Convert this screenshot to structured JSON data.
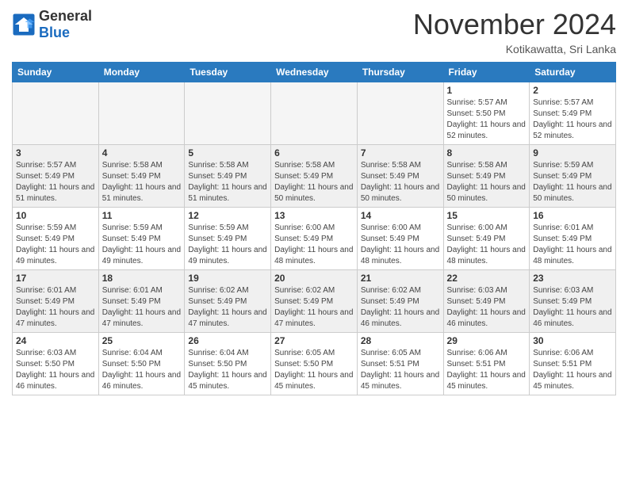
{
  "header": {
    "logo_general": "General",
    "logo_blue": "Blue",
    "month_title": "November 2024",
    "location": "Kotikawatta, Sri Lanka"
  },
  "weekdays": [
    "Sunday",
    "Monday",
    "Tuesday",
    "Wednesday",
    "Thursday",
    "Friday",
    "Saturday"
  ],
  "weeks": [
    [
      {
        "day": "",
        "info": ""
      },
      {
        "day": "",
        "info": ""
      },
      {
        "day": "",
        "info": ""
      },
      {
        "day": "",
        "info": ""
      },
      {
        "day": "",
        "info": ""
      },
      {
        "day": "1",
        "info": "Sunrise: 5:57 AM\nSunset: 5:50 PM\nDaylight: 11 hours and 52 minutes."
      },
      {
        "day": "2",
        "info": "Sunrise: 5:57 AM\nSunset: 5:49 PM\nDaylight: 11 hours and 52 minutes."
      }
    ],
    [
      {
        "day": "3",
        "info": "Sunrise: 5:57 AM\nSunset: 5:49 PM\nDaylight: 11 hours and 51 minutes."
      },
      {
        "day": "4",
        "info": "Sunrise: 5:58 AM\nSunset: 5:49 PM\nDaylight: 11 hours and 51 minutes."
      },
      {
        "day": "5",
        "info": "Sunrise: 5:58 AM\nSunset: 5:49 PM\nDaylight: 11 hours and 51 minutes."
      },
      {
        "day": "6",
        "info": "Sunrise: 5:58 AM\nSunset: 5:49 PM\nDaylight: 11 hours and 50 minutes."
      },
      {
        "day": "7",
        "info": "Sunrise: 5:58 AM\nSunset: 5:49 PM\nDaylight: 11 hours and 50 minutes."
      },
      {
        "day": "8",
        "info": "Sunrise: 5:58 AM\nSunset: 5:49 PM\nDaylight: 11 hours and 50 minutes."
      },
      {
        "day": "9",
        "info": "Sunrise: 5:59 AM\nSunset: 5:49 PM\nDaylight: 11 hours and 50 minutes."
      }
    ],
    [
      {
        "day": "10",
        "info": "Sunrise: 5:59 AM\nSunset: 5:49 PM\nDaylight: 11 hours and 49 minutes."
      },
      {
        "day": "11",
        "info": "Sunrise: 5:59 AM\nSunset: 5:49 PM\nDaylight: 11 hours and 49 minutes."
      },
      {
        "day": "12",
        "info": "Sunrise: 5:59 AM\nSunset: 5:49 PM\nDaylight: 11 hours and 49 minutes."
      },
      {
        "day": "13",
        "info": "Sunrise: 6:00 AM\nSunset: 5:49 PM\nDaylight: 11 hours and 48 minutes."
      },
      {
        "day": "14",
        "info": "Sunrise: 6:00 AM\nSunset: 5:49 PM\nDaylight: 11 hours and 48 minutes."
      },
      {
        "day": "15",
        "info": "Sunrise: 6:00 AM\nSunset: 5:49 PM\nDaylight: 11 hours and 48 minutes."
      },
      {
        "day": "16",
        "info": "Sunrise: 6:01 AM\nSunset: 5:49 PM\nDaylight: 11 hours and 48 minutes."
      }
    ],
    [
      {
        "day": "17",
        "info": "Sunrise: 6:01 AM\nSunset: 5:49 PM\nDaylight: 11 hours and 47 minutes."
      },
      {
        "day": "18",
        "info": "Sunrise: 6:01 AM\nSunset: 5:49 PM\nDaylight: 11 hours and 47 minutes."
      },
      {
        "day": "19",
        "info": "Sunrise: 6:02 AM\nSunset: 5:49 PM\nDaylight: 11 hours and 47 minutes."
      },
      {
        "day": "20",
        "info": "Sunrise: 6:02 AM\nSunset: 5:49 PM\nDaylight: 11 hours and 47 minutes."
      },
      {
        "day": "21",
        "info": "Sunrise: 6:02 AM\nSunset: 5:49 PM\nDaylight: 11 hours and 46 minutes."
      },
      {
        "day": "22",
        "info": "Sunrise: 6:03 AM\nSunset: 5:49 PM\nDaylight: 11 hours and 46 minutes."
      },
      {
        "day": "23",
        "info": "Sunrise: 6:03 AM\nSunset: 5:49 PM\nDaylight: 11 hours and 46 minutes."
      }
    ],
    [
      {
        "day": "24",
        "info": "Sunrise: 6:03 AM\nSunset: 5:50 PM\nDaylight: 11 hours and 46 minutes."
      },
      {
        "day": "25",
        "info": "Sunrise: 6:04 AM\nSunset: 5:50 PM\nDaylight: 11 hours and 46 minutes."
      },
      {
        "day": "26",
        "info": "Sunrise: 6:04 AM\nSunset: 5:50 PM\nDaylight: 11 hours and 45 minutes."
      },
      {
        "day": "27",
        "info": "Sunrise: 6:05 AM\nSunset: 5:50 PM\nDaylight: 11 hours and 45 minutes."
      },
      {
        "day": "28",
        "info": "Sunrise: 6:05 AM\nSunset: 5:51 PM\nDaylight: 11 hours and 45 minutes."
      },
      {
        "day": "29",
        "info": "Sunrise: 6:06 AM\nSunset: 5:51 PM\nDaylight: 11 hours and 45 minutes."
      },
      {
        "day": "30",
        "info": "Sunrise: 6:06 AM\nSunset: 5:51 PM\nDaylight: 11 hours and 45 minutes."
      }
    ]
  ]
}
